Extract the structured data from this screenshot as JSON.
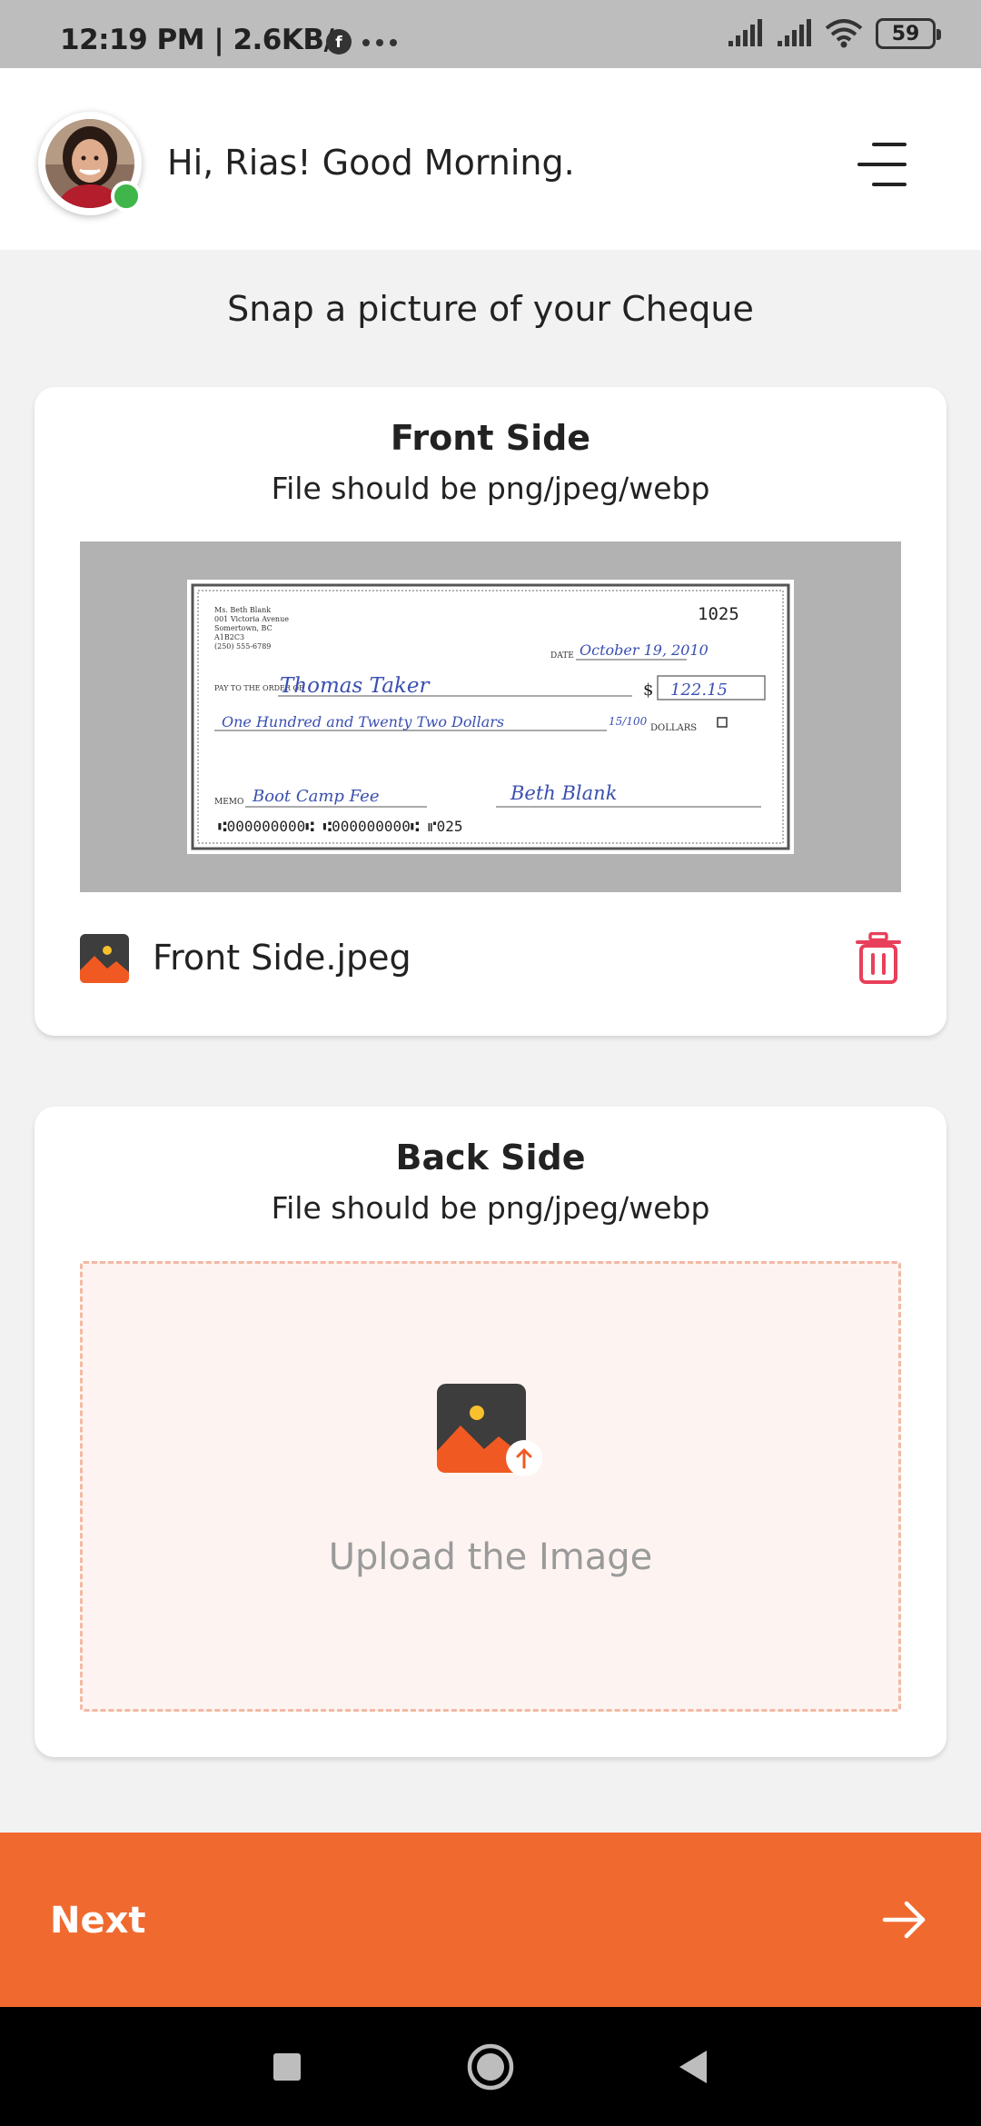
{
  "status_bar": {
    "time": "12:19 PM | 2.6KB/s",
    "battery": "59"
  },
  "header": {
    "greeting": "Hi, Rias! Good Morning."
  },
  "page": {
    "title": "Snap a picture of your Cheque"
  },
  "front_card": {
    "title": "Front Side",
    "subtitle": "File should be png/jpeg/webp",
    "file_name": "Front Side.jpeg"
  },
  "cheque": {
    "number": "1025",
    "address_lines": [
      "Ms. Beth Blank",
      "001 Victoria Avenue",
      "Somertown, BC",
      "A1B2C3",
      "(250) 555-6789"
    ],
    "date_label": "DATE",
    "date": "October 19, 2010",
    "pay_label": "PAY TO THE ORDER OF",
    "payee": "Thomas Taker",
    "amount": "122.15",
    "amount_words": "One Hundred and Twenty Two Dollars",
    "cents": "15/100",
    "dollars_label": "DOLLARS",
    "memo_label": "MEMO",
    "memo": "Boot Camp Fee",
    "signature": "Beth Blank",
    "micr": "⑆000000000⑆ ⑆000000000⑆   ⑈025"
  },
  "back_card": {
    "title": "Back Side",
    "subtitle": "File should be png/jpeg/webp",
    "upload_text": "Upload the Image"
  },
  "footer": {
    "next_label": "Next"
  },
  "icons": {
    "menu": "menu-icon",
    "trash": "trash-icon",
    "image": "image-file-icon",
    "upload": "image-upload-icon",
    "arrow": "arrow-right-icon"
  },
  "colors": {
    "accent": "#f06a30",
    "delete": "#e8405a",
    "online": "#3fb54a",
    "dropzone_bg": "#fdf4f1",
    "dropzone_border": "#f2b9a4",
    "preview_bg": "#b2b2b2"
  }
}
